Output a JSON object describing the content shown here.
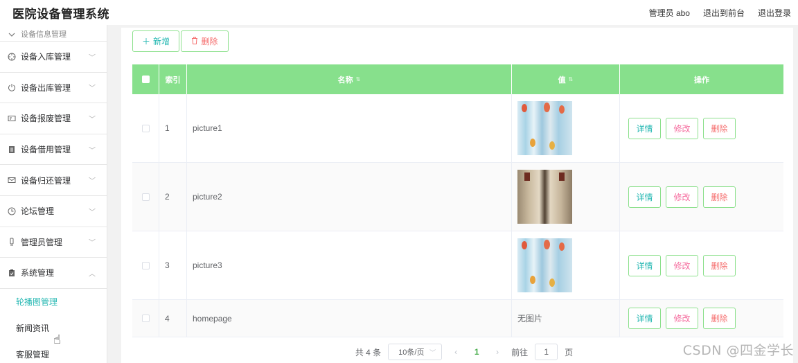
{
  "header": {
    "title": "医院设备管理系统",
    "admin_label": "管理员 abo",
    "to_front": "退出到前台",
    "logout": "退出登录"
  },
  "sidebar": {
    "items": [
      {
        "label": "设备信息管理",
        "icon": "tag-icon"
      },
      {
        "label": "设备入库管理",
        "icon": "target-icon"
      },
      {
        "label": "设备出库管理",
        "icon": "power-icon"
      },
      {
        "label": "设备报废管理",
        "icon": "card-icon"
      },
      {
        "label": "设备借用管理",
        "icon": "document-icon"
      },
      {
        "label": "设备归还管理",
        "icon": "mail-icon"
      },
      {
        "label": "论坛管理",
        "icon": "clock-icon"
      },
      {
        "label": "管理员管理",
        "icon": "phone-icon"
      },
      {
        "label": "系统管理",
        "icon": "clipboard-icon"
      }
    ],
    "sub_items": [
      {
        "label": "轮播图管理",
        "active": true
      },
      {
        "label": "新闻资讯",
        "active": false
      },
      {
        "label": "客服管理",
        "active": false
      }
    ]
  },
  "toolbar": {
    "add_label": "新增",
    "delete_label": "删除"
  },
  "table": {
    "headers": {
      "index": "索引",
      "name": "名称",
      "value": "值",
      "ops": "操作"
    },
    "rows": [
      {
        "index": "1",
        "name": "picture1",
        "value_type": "image-medical",
        "value_text": ""
      },
      {
        "index": "2",
        "name": "picture2",
        "value_type": "image-hallway",
        "value_text": ""
      },
      {
        "index": "3",
        "name": "picture3",
        "value_type": "image-medical",
        "value_text": ""
      },
      {
        "index": "4",
        "name": "homepage",
        "value_type": "text",
        "value_text": "无图片"
      }
    ],
    "ops": {
      "detail": "详情",
      "edit": "修改",
      "remove": "删除"
    }
  },
  "pagination": {
    "total": "共 4 条",
    "page_size": "10条/页",
    "current_page": "1",
    "goto_label": "前往",
    "goto_value": "1",
    "page_suffix": "页"
  },
  "watermark": "CSDN @四金学长",
  "colors": {
    "accent": "#23b7b2",
    "header_green": "#87e08c",
    "danger": "#f56c6c",
    "edit_pink": "#f56c9e"
  }
}
